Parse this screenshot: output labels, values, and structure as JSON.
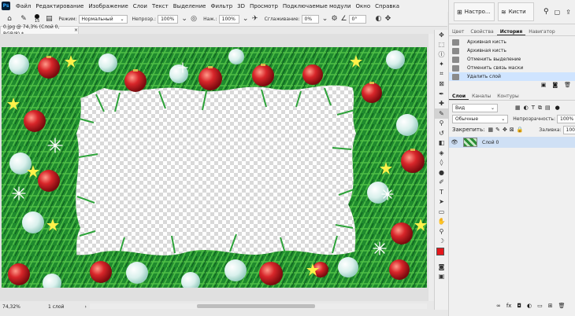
{
  "app": {
    "logo": "Ps"
  },
  "menu": [
    "Файл",
    "Редактирование",
    "Изображение",
    "Слои",
    "Текст",
    "Выделение",
    "Фильтр",
    "3D",
    "Просмотр",
    "Подключаемые модули",
    "Окно",
    "Справка"
  ],
  "options": {
    "mode_label": "Режим:",
    "mode_value": "Нормальный",
    "opacity_label": "Непрозр.:",
    "opacity_value": "100%",
    "flow_label": "Наж.:",
    "flow_value": "100%",
    "smoothing_label": "Сглаживание:",
    "smoothing_value": "0%",
    "angle_value": "0°",
    "brush_size": "15"
  },
  "document": {
    "tab_title": "0.jpg @ 74,3% (Слой 0, RGB/8) *",
    "zoom": "74,32%",
    "status": "1 слой"
  },
  "panels_top": {
    "adjust_label": "Настро...",
    "brushes_label": "Кисти"
  },
  "history": {
    "tabs": [
      "Цвет",
      "Свойства",
      "История",
      "Навигатор"
    ],
    "active_tab": 2,
    "items": [
      "Архивная кисть",
      "Архивная кисть",
      "Отменить выделение",
      "Отменить связь маски",
      "Удалить слой"
    ]
  },
  "layers": {
    "tabs": [
      "Слои",
      "Каналы",
      "Контуры"
    ],
    "active_tab": 0,
    "kind_label": "Вид",
    "blend_value": "Обычные",
    "opacity_label": "Непрозрачность:",
    "opacity_value": "100%",
    "lock_label": "Закрепить:",
    "fill_label": "Заливка:",
    "fill_value": "100%",
    "layer_name": "Слой 0"
  },
  "colors": {
    "accent": "#31a8ff",
    "foreground": "#e4161b",
    "background": "#ffffff"
  }
}
